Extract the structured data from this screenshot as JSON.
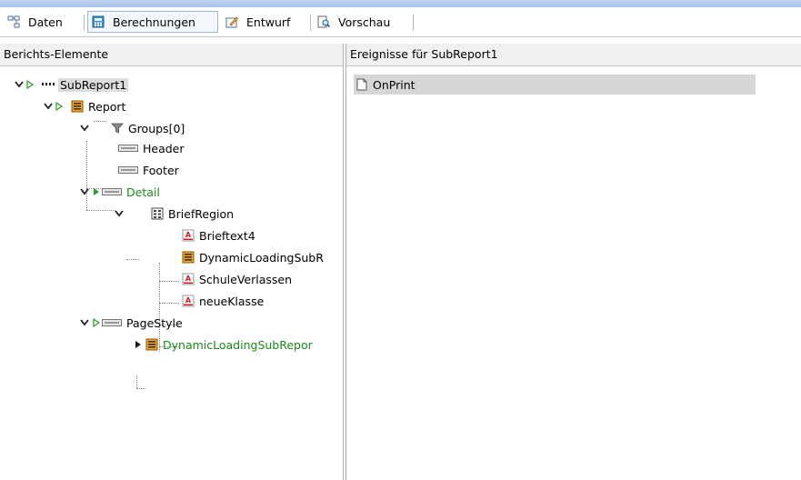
{
  "tabs": [
    {
      "label": "Daten",
      "icon": "data-icon"
    },
    {
      "label": "Berechnungen",
      "icon": "calculator-icon",
      "active": true
    },
    {
      "label": "Entwurf",
      "icon": "design-icon"
    },
    {
      "label": "Vorschau",
      "icon": "preview-icon"
    }
  ],
  "left_pane": {
    "header": "Berichts-Elemente",
    "tree": {
      "subreport": "SubReport1",
      "report": "Report",
      "groups": "Groups[0]",
      "header": "Header",
      "footer": "Footer",
      "detail": "Detail",
      "briefregion": "BriefRegion",
      "brieftext": "Brieftext4",
      "dynamic1": "DynamicLoadingSubR",
      "schule": "SchuleVerlassen",
      "neue": "neueKlasse",
      "pagestyle": "PageStyle",
      "dynamic2": "DynamicLoadingSubRepor"
    }
  },
  "right_pane": {
    "header": "Ereignisse für SubReport1",
    "events": [
      "OnPrint"
    ]
  },
  "colors": {
    "event_text_green": "#1a8a1a",
    "selection_grey": "#dcdcdc"
  }
}
